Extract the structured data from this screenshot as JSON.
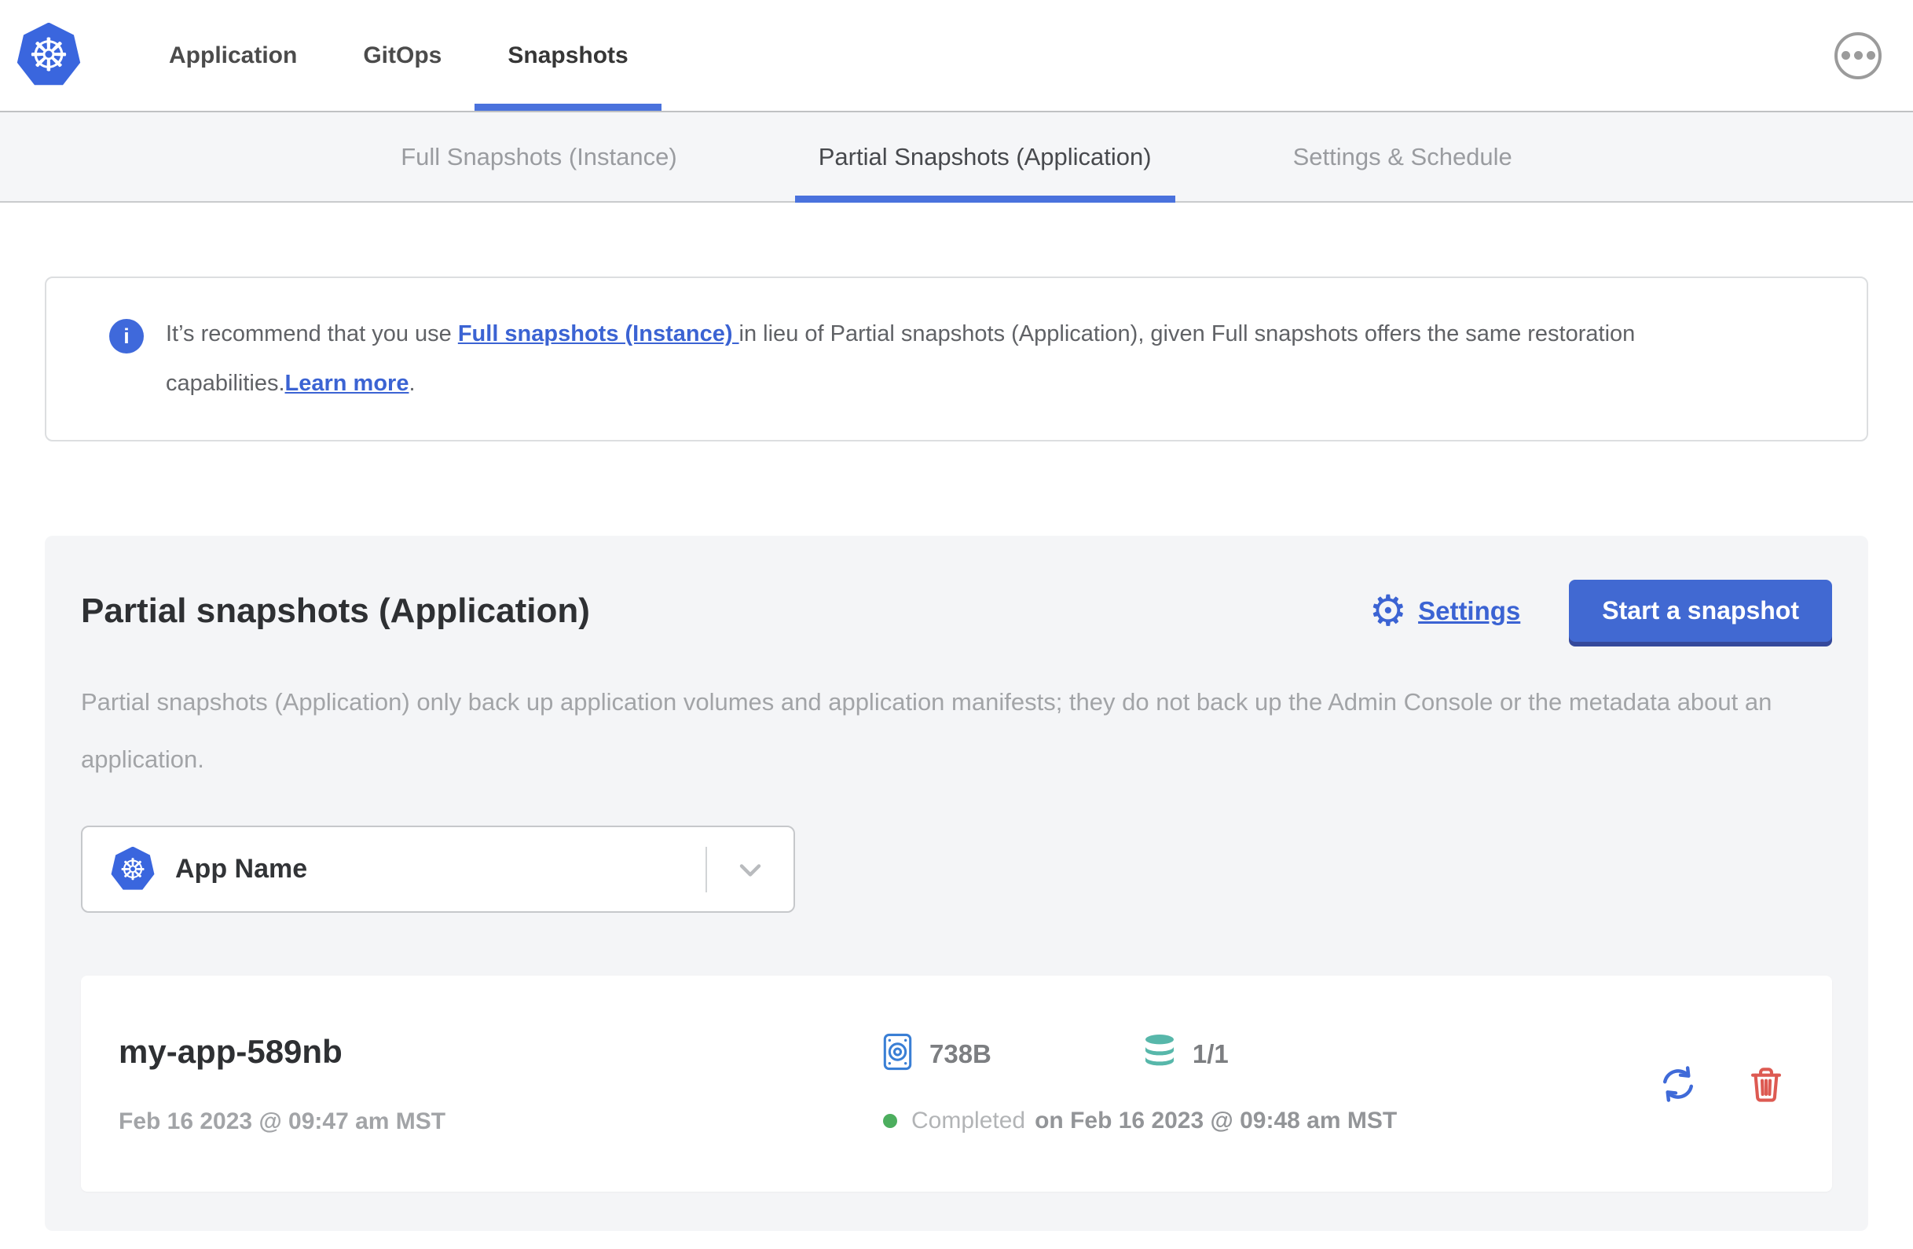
{
  "colors": {
    "accent_blue": "#4a72dd",
    "kubernetes_blue": "#3a66de",
    "link_blue": "#3b63d3",
    "button_blue": "#4169d2",
    "button_edge": "#35499b",
    "teal": "#57b7aa",
    "danger_red": "#dd5a52",
    "success_green": "#4cae5e"
  },
  "header": {
    "logo_icon": "kubernetes-wheel",
    "nav": [
      {
        "label": "Application",
        "active": false
      },
      {
        "label": "GitOps",
        "active": false
      },
      {
        "label": "Snapshots",
        "active": true
      }
    ],
    "overflow_menu_icon": "ellipsis-in-circle"
  },
  "tabs": [
    {
      "label": "Full Snapshots (Instance)",
      "active": false
    },
    {
      "label": "Partial Snapshots (Application)",
      "active": true
    },
    {
      "label": "Settings & Schedule",
      "active": false
    }
  ],
  "banner": {
    "icon": "info-circle",
    "text_before_link": "It’s recommend that you use ",
    "link_full_snapshots": "Full snapshots (Instance) ",
    "text_middle": "in lieu of Partial snapshots (Application), given Full snapshots offers the same restoration capabilities.",
    "link_learn_more": "Learn more",
    "text_after": "."
  },
  "panel": {
    "title": "Partial snapshots (Application)",
    "settings_icon": "gear",
    "settings_label": "Settings",
    "start_snapshot_label": "Start a snapshot",
    "description": "Partial snapshots (Application) only back up application volumes and application manifests; they do not back up the Admin Console or the metadata about an application.",
    "app_selector": {
      "icon": "kubernetes-wheel",
      "value": "App Name",
      "chevron_icon": "chevron-down"
    },
    "snapshot": {
      "name": "my-app-589nb",
      "started": "Feb 16 2023 @ 09:47 am MST",
      "size_icon": "disk",
      "size": "738B",
      "volumes_icon": "database",
      "volumes": "1/1",
      "status": "Completed",
      "finished": "on Feb 16 2023 @ 09:48 am MST",
      "actions": [
        "restore",
        "delete"
      ]
    }
  }
}
